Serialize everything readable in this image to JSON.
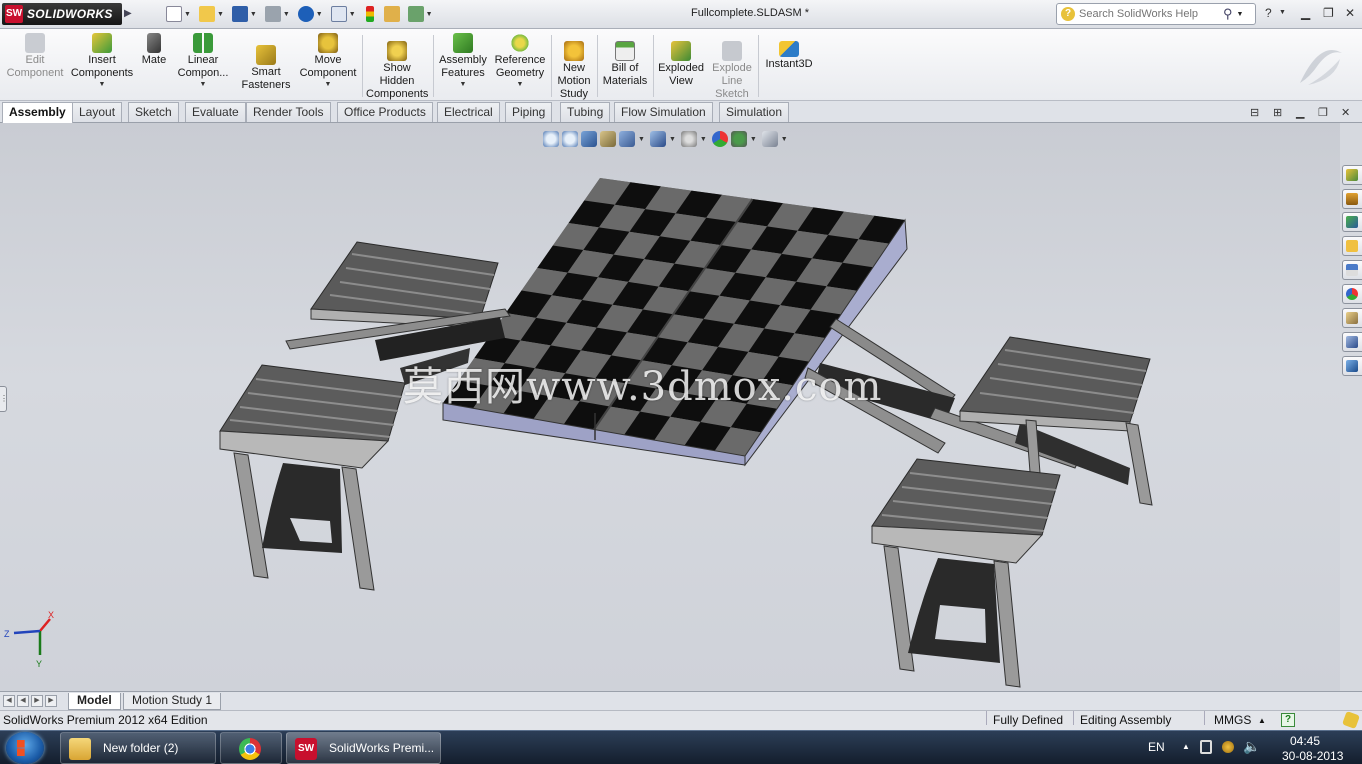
{
  "app": {
    "logo_text": "SOLIDWORKS",
    "document_title": "Fullcomplete.SLDASM *",
    "help_search_placeholder": "Search SolidWorks Help",
    "help_glyph": "?"
  },
  "quick_access": {
    "icons": [
      "new-document-icon",
      "open-icon",
      "save-icon",
      "print-icon",
      "undo-icon",
      "select-icon",
      "rebuild-icon",
      "file-properties-icon",
      "options-icon"
    ]
  },
  "command_manager": {
    "items": [
      {
        "label": "Edit Component",
        "icon": "edit-component-icon",
        "enabled": false,
        "dropdown": false
      },
      {
        "label": "Insert Components",
        "icon": "insert-components-icon",
        "enabled": true,
        "dropdown": true
      },
      {
        "label": "Mate",
        "icon": "mate-icon",
        "enabled": true,
        "dropdown": false
      },
      {
        "label": "Linear Compon...",
        "icon": "linear-pattern-icon",
        "enabled": true,
        "dropdown": true
      },
      {
        "label": "Smart Fasteners",
        "icon": "smart-fasteners-icon",
        "enabled": true,
        "dropdown": false
      },
      {
        "label": "Move Component",
        "icon": "move-component-icon",
        "enabled": true,
        "dropdown": true
      },
      {
        "label": "Show Hidden Components",
        "icon": "show-hidden-icon",
        "enabled": true,
        "dropdown": false
      },
      {
        "label": "Assembly Features",
        "icon": "assembly-features-icon",
        "enabled": true,
        "dropdown": true
      },
      {
        "label": "Reference Geometry",
        "icon": "reference-geometry-icon",
        "enabled": true,
        "dropdown": true
      },
      {
        "label": "New Motion Study",
        "icon": "motion-study-icon",
        "enabled": true,
        "dropdown": false
      },
      {
        "label": "Bill of Materials",
        "icon": "bill-of-materials-icon",
        "enabled": true,
        "dropdown": false
      },
      {
        "label": "Exploded View",
        "icon": "exploded-view-icon",
        "enabled": true,
        "dropdown": false
      },
      {
        "label": "Explode Line Sketch",
        "icon": "explode-line-sketch-icon",
        "enabled": false,
        "dropdown": false
      },
      {
        "label": "Instant3D",
        "icon": "instant3d-icon",
        "enabled": true,
        "dropdown": false
      }
    ]
  },
  "tabs": [
    "Assembly",
    "Layout",
    "Sketch",
    "Evaluate",
    "Render Tools",
    "Office Products",
    "Electrical",
    "Piping",
    "Tubing",
    "Flow Simulation",
    "Simulation"
  ],
  "active_tab": "Assembly",
  "heads_up_toolbar": {
    "icons": [
      "zoom-to-fit-icon",
      "zoom-to-area-icon",
      "previous-view-icon",
      "section-view-icon",
      "view-orientation-icon",
      "display-style-icon",
      "hide-show-items-icon",
      "edit-appearance-icon",
      "apply-scene-icon",
      "view-settings-icon"
    ]
  },
  "viewport": {
    "watermark": "莫西网www.3dmox.com",
    "triad_labels": {
      "x": "X",
      "y": "Y",
      "z": "Z"
    }
  },
  "task_pane": {
    "icons": [
      "solidworks-resources-icon",
      "design-library-icon",
      "file-explorer-icon",
      "view-palette-icon",
      "appearances-icon",
      "custom-properties-icon",
      "3dcontentcentral-icon",
      "search-results-icon",
      "folder-icon"
    ]
  },
  "bottom_tabs": [
    "Model",
    "Motion Study 1"
  ],
  "active_bottom_tab": "Model",
  "status_bar": {
    "edition": "SolidWorks Premium 2012 x64 Edition",
    "state": "Fully Defined",
    "mode": "Editing Assembly",
    "units": "MMGS",
    "units_caret": "▲",
    "help_glyph": "?"
  },
  "taskbar": {
    "items": [
      {
        "label": "New folder (2)",
        "icon": "folder-icon"
      },
      {
        "label": "",
        "icon": "chrome-icon"
      },
      {
        "label": "SolidWorks Premi...",
        "icon": "solidworks-icon"
      }
    ],
    "language": "EN",
    "time": "04:45",
    "date": "30-08-2013"
  },
  "colors": {
    "accent": "#c8102e",
    "viewport_bg": "#d0d3d9",
    "bench_slat": "#6e6e6e",
    "checker_dark": "#0e0e0e",
    "checker_light": "#6a6a6a"
  }
}
